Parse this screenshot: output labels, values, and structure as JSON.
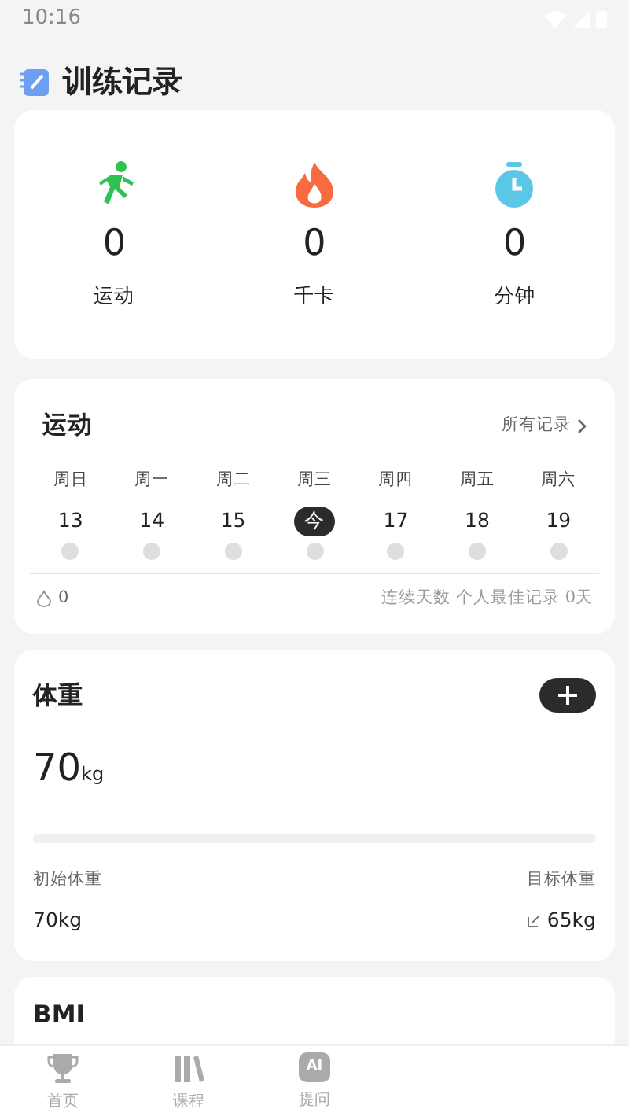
{
  "status_bar": {
    "time": "10:16"
  },
  "header": {
    "title": "训练记录"
  },
  "summary": [
    {
      "kind": "run",
      "value": "0",
      "label": "运动"
    },
    {
      "kind": "fire",
      "value": "0",
      "label": "千卡"
    },
    {
      "kind": "timer",
      "value": "0",
      "label": "分钟"
    }
  ],
  "exercise": {
    "title": "运动",
    "link": "所有记录",
    "days": [
      {
        "weekday": "周日",
        "date": "13",
        "selected": false,
        "done": false
      },
      {
        "weekday": "周一",
        "date": "14",
        "selected": false,
        "done": false
      },
      {
        "weekday": "周二",
        "date": "15",
        "selected": false,
        "done": false
      },
      {
        "weekday": "周三",
        "date": "今",
        "selected": true,
        "done": false
      },
      {
        "weekday": "周四",
        "date": "17",
        "selected": false,
        "done": false
      },
      {
        "weekday": "周五",
        "date": "18",
        "selected": false,
        "done": false
      },
      {
        "weekday": "周六",
        "date": "19",
        "selected": false,
        "done": false
      }
    ],
    "streak": "0",
    "best_record": "连续天数 个人最佳记录 0天"
  },
  "weight": {
    "title": "体重",
    "value": "70",
    "unit": "kg",
    "start_label": "初始体重",
    "start_value": "70kg",
    "target_label": "目标体重",
    "target_value": "65kg"
  },
  "bmi": {
    "title": "BMI"
  },
  "bottom_nav": [
    {
      "kind": "trophy",
      "label": "首页",
      "selected": false
    },
    {
      "kind": "books",
      "label": "课程",
      "selected": false
    },
    {
      "kind": "ai",
      "icon_text": "AI",
      "label": "提问",
      "selected": false
    }
  ]
}
